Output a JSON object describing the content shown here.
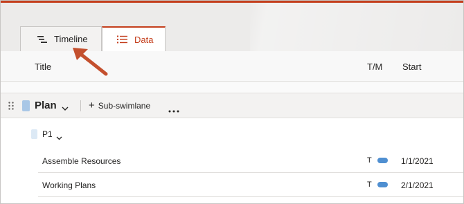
{
  "tabs": [
    {
      "label": "Timeline",
      "icon": "timeline-icon",
      "active": false
    },
    {
      "label": "Data",
      "icon": "list-icon",
      "active": true
    }
  ],
  "columns": {
    "title": "Title",
    "tm": "T/M",
    "start": "Start"
  },
  "swimlane": {
    "label": "Plan",
    "color": "#a9c7e6",
    "add_label": "Sub-swimlane",
    "more_icon": "more-icon"
  },
  "group": {
    "label": "P1",
    "color": "#dce9f5"
  },
  "tasks": [
    {
      "title": "Assemble Resources",
      "tm": "T",
      "start": "1/1/2021"
    },
    {
      "title": "Working Plans",
      "tm": "T",
      "start": "2/1/2021"
    }
  ],
  "colors": {
    "accent": "#c43e1c",
    "task_bar": "#4f8fd1",
    "annotation_arrow": "#c4502e"
  }
}
